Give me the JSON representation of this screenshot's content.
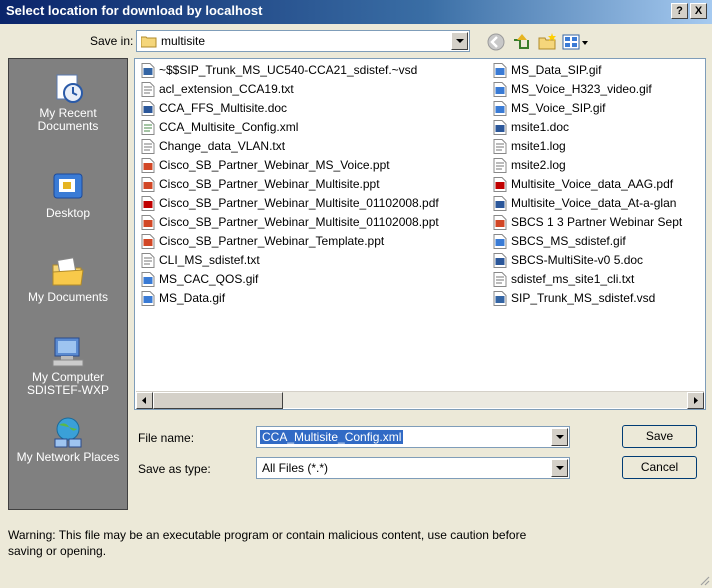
{
  "window": {
    "title": "Select location for download by localhost"
  },
  "title_buttons": {
    "help": "?",
    "close": "X"
  },
  "save_in": {
    "label": "Save in:",
    "value": "multisite"
  },
  "places": [
    {
      "label": "My Recent Documents",
      "icon": "recent-documents-icon"
    },
    {
      "label": "Desktop",
      "icon": "desktop-icon"
    },
    {
      "label": "My Documents",
      "icon": "my-documents-icon"
    },
    {
      "label": "My Computer SDISTEF-WXP",
      "icon": "my-computer-icon"
    },
    {
      "label": "My Network Places",
      "icon": "network-places-icon"
    }
  ],
  "files_col1": [
    {
      "name": "~$$SIP_Trunk_MS_UC540-CCA21_sdistef.~vsd",
      "icon": "vsd"
    },
    {
      "name": "acl_extension_CCA19.txt",
      "icon": "txt"
    },
    {
      "name": "CCA_FFS_Multisite.doc",
      "icon": "doc"
    },
    {
      "name": "CCA_Multisite_Config.xml",
      "icon": "xml"
    },
    {
      "name": "Change_data_VLAN.txt",
      "icon": "txt"
    },
    {
      "name": "Cisco_SB_Partner_Webinar_MS_Voice.ppt",
      "icon": "ppt"
    },
    {
      "name": "Cisco_SB_Partner_Webinar_Multisite.ppt",
      "icon": "ppt"
    },
    {
      "name": "Cisco_SB_Partner_Webinar_Multisite_01102008.pdf",
      "icon": "pdf"
    },
    {
      "name": "Cisco_SB_Partner_Webinar_Multisite_01102008.ppt",
      "icon": "ppt"
    },
    {
      "name": "Cisco_SB_Partner_Webinar_Template.ppt",
      "icon": "ppt"
    },
    {
      "name": "CLI_MS_sdistef.txt",
      "icon": "txt"
    },
    {
      "name": "MS_CAC_QOS.gif",
      "icon": "gif"
    },
    {
      "name": "MS_Data.gif",
      "icon": "gif"
    }
  ],
  "files_col2": [
    {
      "name": "MS_Data_SIP.gif",
      "icon": "gif"
    },
    {
      "name": "MS_Voice_H323_video.gif",
      "icon": "gif"
    },
    {
      "name": "MS_Voice_SIP.gif",
      "icon": "gif"
    },
    {
      "name": "msite1.doc",
      "icon": "doc"
    },
    {
      "name": "msite1.log",
      "icon": "txt"
    },
    {
      "name": "msite2.log",
      "icon": "txt"
    },
    {
      "name": "Multisite_Voice_data_AAG.pdf",
      "icon": "pdf"
    },
    {
      "name": "Multisite_Voice_data_At-a-glan",
      "icon": "doc"
    },
    {
      "name": "SBCS 1 3 Partner Webinar Sept",
      "icon": "ppt"
    },
    {
      "name": "SBCS_MS_sdistef.gif",
      "icon": "gif"
    },
    {
      "name": "SBCS-MultiSite-v0 5.doc",
      "icon": "doc"
    },
    {
      "name": "sdistef_ms_site1_cli.txt",
      "icon": "txt"
    },
    {
      "name": "SIP_Trunk_MS_sdistef.vsd",
      "icon": "vsd"
    }
  ],
  "file_name": {
    "label": "File name:",
    "value": "CCA_Multisite_Config.xml"
  },
  "save_type": {
    "label": "Save as type:",
    "value": "All Files (*.*)"
  },
  "buttons": {
    "save": "Save",
    "cancel": "Cancel"
  },
  "warning": "Warning: This file may be an executable program or contain malicious content, use caution before saving or opening.",
  "icon_colors": {
    "doc": "#2b579a",
    "ppt": "#d24726",
    "pdf": "#c00000",
    "gif": "#3a7bd5",
    "txt": "#777777",
    "xml": "#4a8a4a",
    "vsd": "#3465a4"
  }
}
